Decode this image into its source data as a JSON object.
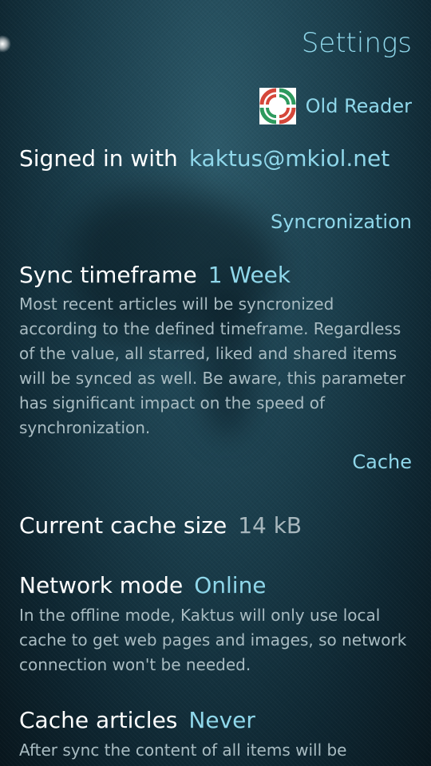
{
  "header": {
    "title": "Settings"
  },
  "account": {
    "provider_name": "Old Reader",
    "provider_logo_icon": "old-reader-logo",
    "signed_in_label": "Signed in with",
    "signed_in_value": "kaktus@mkiol.net"
  },
  "sections": {
    "sync": "Syncronization",
    "cache": "Cache"
  },
  "sync_timeframe": {
    "label": "Sync timeframe",
    "value": "1 Week",
    "description": "Most recent articles will be syncronized according to the defined timeframe. Regardless of the value, all starred, liked and shared items will be synced as well. Be aware, this parameter has significant impact on the speed of synchronization."
  },
  "cache_size": {
    "label": "Current cache size",
    "value": "14 kB"
  },
  "network_mode": {
    "label": "Network mode",
    "value": "Online",
    "description": "In the offline mode, Kaktus will only use local cache to get web pages and images, so network connection won't be needed."
  },
  "cache_articles": {
    "label": "Cache articles",
    "value": "Never",
    "description": "After sync the content of all items will be"
  },
  "colors": {
    "accent": "#8fd7ea",
    "secondary_text": "#a9bcc2",
    "primary_text": "#ffffff"
  }
}
